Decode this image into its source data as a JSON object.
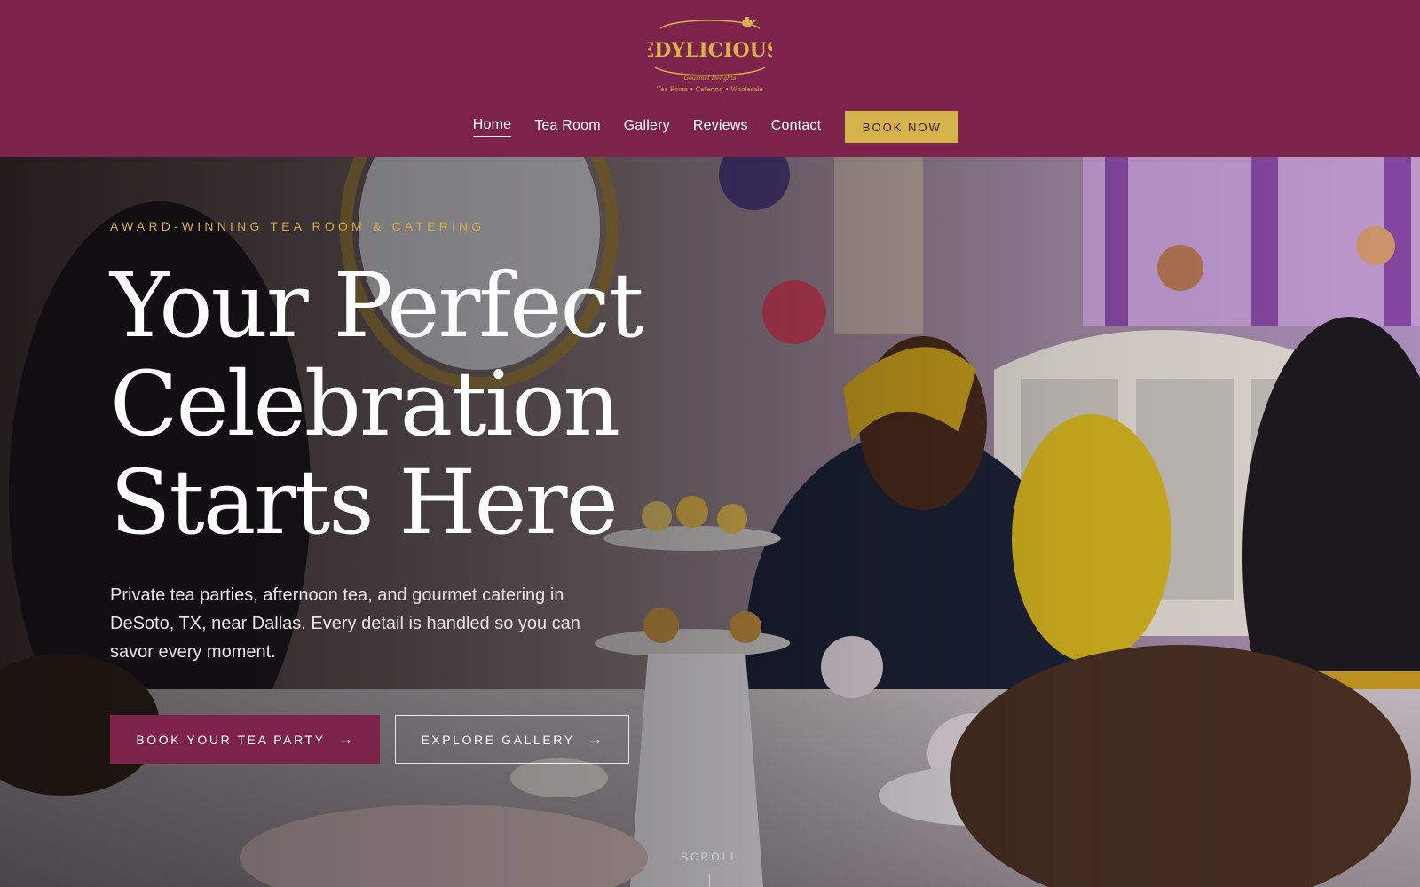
{
  "brand": {
    "name": "EDYLICIOUS",
    "tagline": "Gourmet Delights",
    "services": "Tea Room • Catering • Wholesale"
  },
  "nav": {
    "items": [
      {
        "label": "Home",
        "active": true
      },
      {
        "label": "Tea Room"
      },
      {
        "label": "Gallery"
      },
      {
        "label": "Reviews"
      },
      {
        "label": "Contact"
      }
    ],
    "cta": "BOOK NOW"
  },
  "hero": {
    "eyebrow": "AWARD-WINNING TEA ROOM & CATERING",
    "headline_line1": "Your Perfect",
    "headline_line2": "Celebration",
    "headline_line3": "Starts Here",
    "subtext": "Private tea parties, afternoon tea, and gourmet catering in DeSoto, TX, near Dallas. Every detail is handled so you can savor every moment.",
    "primary_cta": "BOOK YOUR TEA PARTY",
    "secondary_cta": "EXPLORE GALLERY",
    "arrow": "→",
    "scroll_label": "SCROLL"
  },
  "colors": {
    "brand_plum": "#7d234b",
    "gold": "#d6b24b",
    "eyebrow_gold": "#d6a94a"
  }
}
